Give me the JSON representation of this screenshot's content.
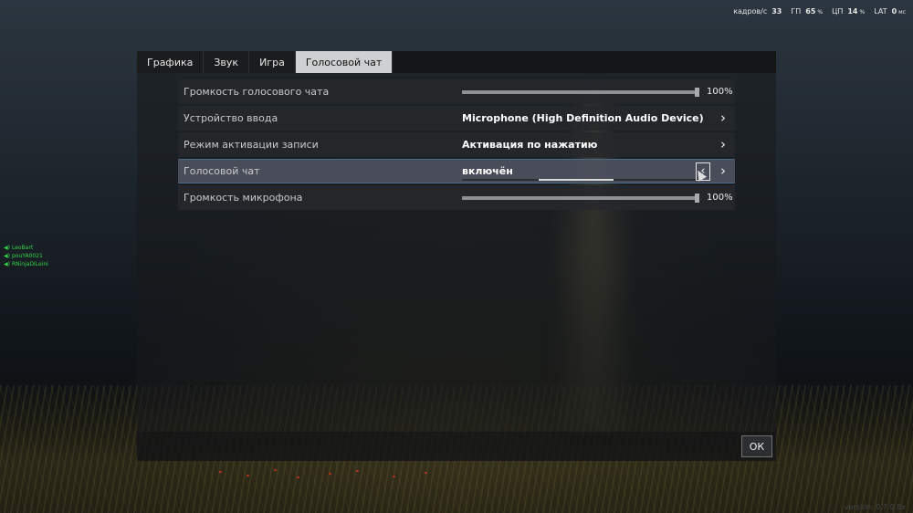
{
  "hud": {
    "fps_label": "кадров/с",
    "fps_value": "33",
    "gpu_label": "ГП",
    "gpu_value": "65",
    "gpu_unit": "%",
    "cpu_label": "ЦП",
    "cpu_value": "14",
    "cpu_unit": "%",
    "lat_label": "LAT",
    "lat_value": "0",
    "lat_unit": "мс"
  },
  "voice_players": [
    "LeoBart",
    "pouYA0021",
    "RNinjaDiLeini"
  ],
  "version": "version: 0.7.0.8x",
  "tabs": [
    {
      "label": "Графика",
      "active": false
    },
    {
      "label": "Звук",
      "active": false
    },
    {
      "label": "Игра",
      "active": false
    },
    {
      "label": "Голосовой чат",
      "active": true
    }
  ],
  "settings": {
    "voice_volume": {
      "label": "Громкость голосового чата",
      "value": 100,
      "display": "100%"
    },
    "input_device": {
      "label": "Устройство ввода",
      "value": "Microphone (High Definition Audio Device)"
    },
    "activation_mode": {
      "label": "Режим активации записи",
      "value": "Активация по нажатию"
    },
    "voice_chat": {
      "label": "Голосовой чат",
      "value": "включён"
    },
    "mic_volume": {
      "label": "Громкость микрофона",
      "value": 100,
      "display": "100%"
    }
  },
  "icons": {
    "next": "chevron-right-icon",
    "prev": "chevron-left-icon",
    "speaker": "speaker-icon"
  },
  "footer": {
    "ok_label": "ОК"
  },
  "colors": {
    "accent_active_tab": "#cfd0d2",
    "voice_green": "#35d44a",
    "highlight_border": "#4a6b85"
  }
}
